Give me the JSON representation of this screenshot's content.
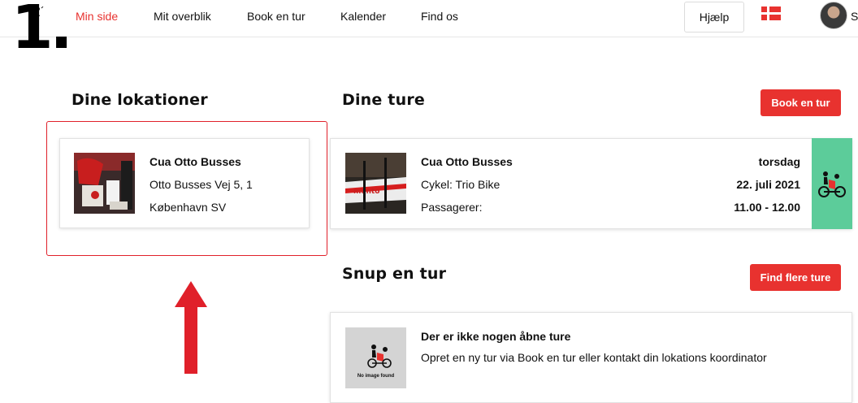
{
  "overlay": {
    "step_label": "1."
  },
  "nav": {
    "items": [
      {
        "label": "Min side",
        "active": true
      },
      {
        "label": "Mit overblik"
      },
      {
        "label": "Book en tur"
      },
      {
        "label": "Kalender"
      },
      {
        "label": "Find os"
      }
    ],
    "help_label": "Hjælp",
    "avatar_initial": "S"
  },
  "locations": {
    "title": "Dine lokationer",
    "card": {
      "name": "Cua Otto Busses",
      "address_line1": "Otto Busses Vej 5, 1",
      "address_line2": "København SV"
    }
  },
  "trips": {
    "title": "Dine ture",
    "book_button": "Book en tur",
    "card": {
      "name": "Cua Otto Busses",
      "bike": "Cykel: Trio Bike",
      "passengers": "Passagerer:",
      "weekday": "torsdag",
      "date": "22. juli 2021",
      "time": "11.00 - 12.00"
    }
  },
  "open_trips": {
    "title": "Snup en tur",
    "find_button": "Find flere ture",
    "empty": {
      "image_label": "No image found",
      "heading": "Der er ikke nogen åbne ture",
      "message": "Opret en ny tur via Book en tur eller kontakt din lokations koordinator"
    }
  },
  "colors": {
    "accent": "#e8322f",
    "status_green": "#5ccc9a",
    "highlight": "#e0202a"
  }
}
